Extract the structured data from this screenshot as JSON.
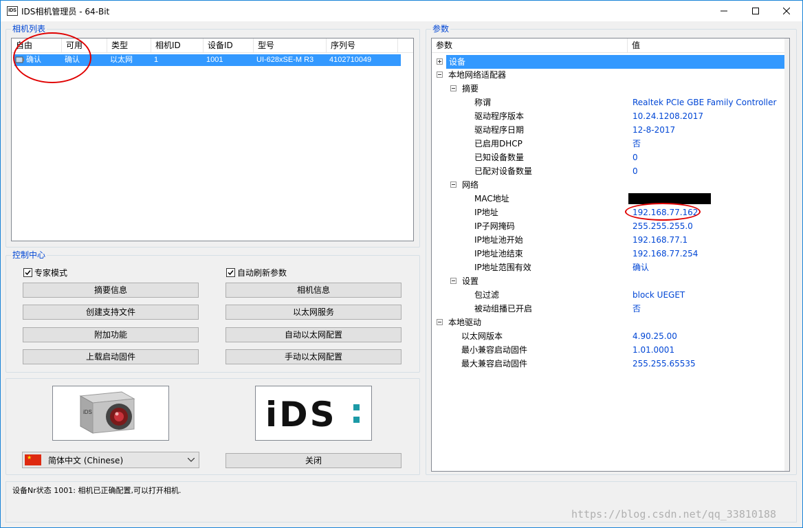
{
  "window": {
    "icon_text": "IDS",
    "title": "IDS相机管理员 - 64-Bit"
  },
  "camera_list": {
    "group_title": "相机列表",
    "columns": [
      "自由",
      "可用",
      "类型",
      "相机ID",
      "设备ID",
      "型号",
      "序列号"
    ],
    "rows": [
      [
        "确认",
        "确认",
        "以太网",
        "1",
        "1001",
        "UI-628xSE-M R3",
        "4102710049"
      ]
    ]
  },
  "control_center": {
    "group_title": "控制中心",
    "expert_mode_label": "专家模式",
    "expert_mode_checked": true,
    "auto_refresh_label": "自动刷新参数",
    "auto_refresh_checked": true,
    "buttons": {
      "summary": "摘要信息",
      "camera_info": "相机信息",
      "support_file": "创建支持文件",
      "ethernet_service": "以太网服务",
      "additional": "附加功能",
      "auto_eth_config": "自动以太网配置",
      "upload_firmware": "上载启动固件",
      "manual_eth_config": "手动以太网配置"
    }
  },
  "bottom_panel": {
    "logo_text": "iDS",
    "language": "简体中文 (Chinese)",
    "close_label": "关闭"
  },
  "parameters": {
    "group_title": "参数",
    "header_param": "参数",
    "header_value": "值",
    "rows": [
      {
        "name": "设备",
        "value": ""
      },
      {
        "name": "本地网络适配器",
        "value": ""
      },
      {
        "name": "摘要",
        "value": ""
      },
      {
        "name": "称谓",
        "value": "Realtek PCIe GBE Family Controller"
      },
      {
        "name": "驱动程序版本",
        "value": "10.24.1208.2017"
      },
      {
        "name": "驱动程序日期",
        "value": "12-8-2017"
      },
      {
        "name": "已启用DHCP",
        "value": "否"
      },
      {
        "name": "已知设备数量",
        "value": "0"
      },
      {
        "name": "已配对设备数量",
        "value": "0"
      },
      {
        "name": "网络",
        "value": ""
      },
      {
        "name": "MAC地址",
        "value": ""
      },
      {
        "name": "IP地址",
        "value": "192.168.77.162"
      },
      {
        "name": "IP子网掩码",
        "value": "255.255.255.0"
      },
      {
        "name": "IP地址池开始",
        "value": "192.168.77.1"
      },
      {
        "name": "IP地址池结束",
        "value": "192.168.77.254"
      },
      {
        "name": "IP地址范围有效",
        "value": "确认"
      },
      {
        "name": "设置",
        "value": ""
      },
      {
        "name": "包过滤",
        "value": "block UEGET"
      },
      {
        "name": "被动组播已开启",
        "value": "否"
      },
      {
        "name": "本地驱动",
        "value": ""
      },
      {
        "name": "以太网版本",
        "value": "4.90.25.00"
      },
      {
        "name": "最小兼容启动固件",
        "value": "1.01.0001"
      },
      {
        "name": "最大兼容启动固件",
        "value": "255.255.65535"
      }
    ]
  },
  "status": {
    "text": "设备Nr状态 1001: 相机已正确配置,可以打开相机."
  },
  "watermark": "https://blog.csdn.net/qq_33810188",
  "colors": {
    "accent_blue": "#0046d5",
    "selection": "#3399ff",
    "annotation_red": "#e00000"
  }
}
